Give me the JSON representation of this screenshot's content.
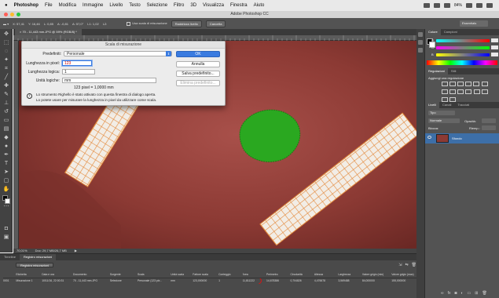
{
  "menubar": {
    "app": "Photoshop",
    "items": [
      "File",
      "Modifica",
      "Immagine",
      "Livello",
      "Testo",
      "Selezione",
      "Filtro",
      "3D",
      "Visualizza",
      "Finestra",
      "Aiuto"
    ],
    "battery": "84%"
  },
  "window": {
    "title": "Adobe Photoshop CC"
  },
  "options": {
    "coords": [
      "X: 57,41",
      "Y: 16,46",
      "L: 0,85",
      "A: -0,81",
      "A: 57,0°",
      "L1: 1,02",
      "L2:"
    ],
    "use_scale_label": "Usa scala di misurazione",
    "straighten_button": "Raddrizza livello",
    "clear_button": "Cancella",
    "workspace": "Essentials"
  },
  "document": {
    "tab": "70 - 11,443 mm.JPG @ 59% (RGB/8) *",
    "status_zoom": "70,01%",
    "status_doc": "Doc: 29,7 MB/26,7 MB"
  },
  "dialog": {
    "title": "Scala di misurazione",
    "preset_label": "Predefiniti:",
    "preset_value": "Personale",
    "pixel_length_label": "Lunghezza in pixel:",
    "pixel_length_value": "123",
    "logical_length_label": "Lunghezza logica:",
    "logical_length_value": "1",
    "logical_units_label": "Unità logiche:",
    "logical_units_value": "mm",
    "ok": "OK",
    "cancel": "Annulla",
    "save_preset": "Salva predefinito...",
    "delete_preset": "Elimina predefinito...",
    "pixel_info": "123 pixel = 1,0000 mm",
    "note_line1": "Lo strumento Righello è stato attivato con questa finestra di dialogo aperta.",
    "note_line2": "Lo potete usare per misurare la lunghezza in pixel da utilizzare come scala."
  },
  "log": {
    "tabs": [
      "Timeline",
      "Registro misurazioni"
    ],
    "active_tab": 1,
    "record_button": "Registra misurazioni",
    "columns": [
      "Etichetta",
      "Data e ora",
      "Documento",
      "Sorgente",
      "Scala",
      "Unità scala",
      "Fattore scala",
      "Conteggio",
      "Area",
      "Perimetro",
      "Circolarità",
      "Altezza",
      "Larghezza",
      "Valore grigio (min)",
      "Valore grigio (max)"
    ],
    "rows": [
      [
        "0001",
        "Misurazione 1",
        "10/11/16, 22:00:31",
        "70 - 11,443 mm.JPG",
        "Selezione",
        "Personale (123 pix...",
        "mm",
        "123,000000",
        "1",
        "11,811222",
        "14,678386",
        "0,704826",
        "4,476678",
        "3,569488",
        "84,000000",
        "155,000000"
      ]
    ]
  },
  "right_panel": {
    "color_tabs": [
      "Colore",
      "Campioni"
    ],
    "sliders": [
      {
        "label": "R",
        "gradient": [
          "#00ffff",
          "#ff0000"
        ]
      },
      {
        "label": "G",
        "gradient": [
          "#ff00ff",
          "#00ff00"
        ]
      },
      {
        "label": "B",
        "gradient": [
          "#ffff00",
          "#0000ff"
        ]
      }
    ],
    "adjust_tabs": [
      "Regolazioni",
      "Stili"
    ],
    "adjust_title": "Aggiungi una regolazione",
    "layer_tabs": [
      "Livelli",
      "Canali",
      "Tracciati"
    ],
    "layer_kind": "Tipo",
    "blend_mode": "Normale",
    "opacity_label": "Opacità:",
    "lock_label": "Blocca:",
    "fill_label": "Riemp.:",
    "layer_name": "Sfondo"
  },
  "colors": {
    "tissue": "#8c3a34",
    "green_region": "#2aa820",
    "ruler_orange": "#e48a3c",
    "accent_blue": "#3a7be0"
  }
}
